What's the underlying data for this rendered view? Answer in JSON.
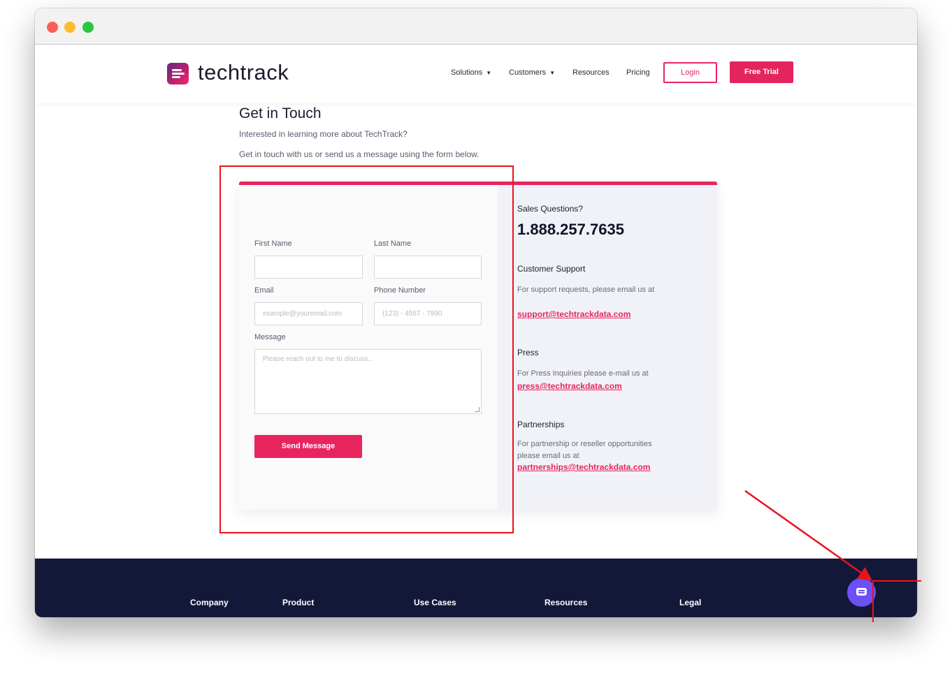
{
  "header": {
    "logo_text": "techtrack",
    "nav": [
      "Solutions",
      "Customers",
      "Resources",
      "Pricing"
    ],
    "login_label": "Login",
    "trial_label": "Free Trial"
  },
  "main": {
    "title": "Get in Touch",
    "intro_1": "Interested in learning more about TechTrack?",
    "intro_2": "Get in touch with us or send us a message using the form below."
  },
  "form": {
    "first_name_label": "First Name",
    "last_name_label": "Last Name",
    "email_label": "Email",
    "email_placeholder": "example@youremail.com",
    "phone_label": "Phone Number",
    "phone_placeholder": "(123) - 4567 - 7890",
    "message_label": "Message",
    "message_placeholder": "Please reach out to me to discuss...",
    "send_label": "Send Message"
  },
  "info": {
    "sales_heading": "Sales Questions?",
    "phone_number": "1.888.257.7635",
    "support_heading": "Customer Support",
    "support_text": "For support requests, please email us at",
    "support_email": "support@techtrackdata.com",
    "press_heading": "Press",
    "press_text": "For Press Inquiries please e-mail us at",
    "press_email": "press@techtrackdata.com",
    "partnerships_heading": "Partnerships",
    "partnerships_text_1": "For partnership or reseller opportunities",
    "partnerships_text_2": "please email us at",
    "partnerships_email": "partnerships@techtrackdata.com"
  },
  "footer": {
    "items": [
      "Company",
      "Product",
      "Use Cases",
      "Resources",
      "Legal"
    ]
  },
  "colors": {
    "accent": "#e8245f",
    "footer_bg": "#141838",
    "chat_button": "#6c4ff5",
    "annotation": "#e8141b"
  }
}
